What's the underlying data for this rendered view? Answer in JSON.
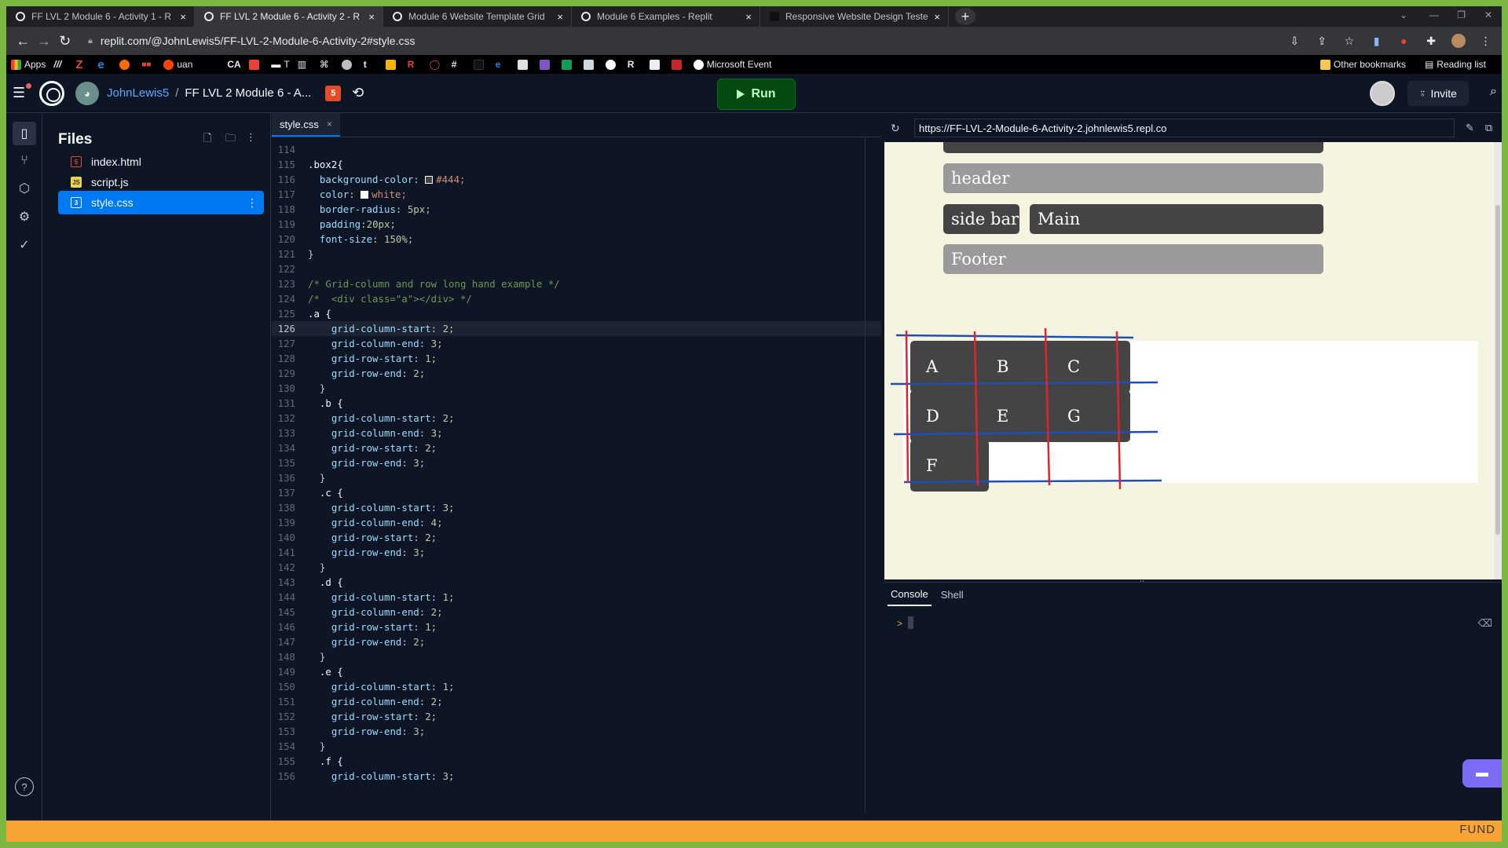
{
  "browser": {
    "tabs": [
      {
        "title": "FF LVL 2 Module 6 - Activity 1 - R",
        "active": false
      },
      {
        "title": "FF LVL 2 Module 6 - Activity 2 - R",
        "active": true
      },
      {
        "title": "Module 6 Website Template Grid",
        "active": false
      },
      {
        "title": "Module 6 Examples - Replit",
        "active": false
      },
      {
        "title": "Responsive Website Design Teste",
        "active": false
      }
    ],
    "url": "replit.com/@JohnLewis5/FF-LVL-2-Module-6-Activity-2#style.css",
    "bookmarks": {
      "apps": "Apps",
      "uan": "uan",
      "ca": "CA",
      "t": "T",
      "microsoft_event": "Microsoft Event",
      "other": "Other bookmarks",
      "reading_list": "Reading list"
    }
  },
  "replit": {
    "owner": "JohnLewis5",
    "separator": "/",
    "repl_name": "FF LVL 2 Module 6 - A...",
    "run_label": "Run",
    "invite_label": "Invite",
    "files_title": "Files",
    "files": [
      {
        "name": "index.html",
        "type": "html"
      },
      {
        "name": "script.js",
        "type": "js"
      },
      {
        "name": "style.css",
        "type": "css",
        "active": true
      }
    ],
    "editor_tab": "style.css",
    "help": "?"
  },
  "code_lines": [
    {
      "n": "114",
      "t": ""
    },
    {
      "n": "115",
      "t": ".box2{"
    },
    {
      "n": "116",
      "t": "  background-color: ",
      "sw": "#444",
      "v": "#444;"
    },
    {
      "n": "117",
      "t": "  color: ",
      "sw": "#ffffff",
      "v": "white;"
    },
    {
      "n": "118",
      "t": "  border-radius: 5px;"
    },
    {
      "n": "119",
      "t": "  padding:20px;"
    },
    {
      "n": "120",
      "t": "  font-size: 150%;"
    },
    {
      "n": "121",
      "t": "}"
    },
    {
      "n": "122",
      "t": ""
    },
    {
      "n": "123",
      "t": "/* Grid-column and row long hand example */",
      "c": true
    },
    {
      "n": "124",
      "t": "/*  <div class=\"a\"></div> */",
      "c": true
    },
    {
      "n": "125",
      "t": ".a {"
    },
    {
      "n": "126",
      "t": "    grid-column-start: 2;",
      "cur": true
    },
    {
      "n": "127",
      "t": "    grid-column-end: 3;"
    },
    {
      "n": "128",
      "t": "    grid-row-start: 1;"
    },
    {
      "n": "129",
      "t": "    grid-row-end: 2;"
    },
    {
      "n": "130",
      "t": "  }"
    },
    {
      "n": "131",
      "t": "  .b {"
    },
    {
      "n": "132",
      "t": "    grid-column-start: 2;"
    },
    {
      "n": "133",
      "t": "    grid-column-end: 3;"
    },
    {
      "n": "134",
      "t": "    grid-row-start: 2;"
    },
    {
      "n": "135",
      "t": "    grid-row-end: 3;"
    },
    {
      "n": "136",
      "t": "  }"
    },
    {
      "n": "137",
      "t": "  .c {"
    },
    {
      "n": "138",
      "t": "    grid-column-start: 3;"
    },
    {
      "n": "139",
      "t": "    grid-column-end: 4;"
    },
    {
      "n": "140",
      "t": "    grid-row-start: 2;"
    },
    {
      "n": "141",
      "t": "    grid-row-end: 3;"
    },
    {
      "n": "142",
      "t": "  }"
    },
    {
      "n": "143",
      "t": "  .d {"
    },
    {
      "n": "144",
      "t": "    grid-column-start: 1;"
    },
    {
      "n": "145",
      "t": "    grid-column-end: 2;"
    },
    {
      "n": "146",
      "t": "    grid-row-start: 1;"
    },
    {
      "n": "147",
      "t": "    grid-row-end: 2;"
    },
    {
      "n": "148",
      "t": "  }"
    },
    {
      "n": "149",
      "t": "  .e {"
    },
    {
      "n": "150",
      "t": "    grid-column-start: 1;"
    },
    {
      "n": "151",
      "t": "    grid-column-end: 2;"
    },
    {
      "n": "152",
      "t": "    grid-row-start: 2;"
    },
    {
      "n": "153",
      "t": "    grid-row-end: 3;"
    },
    {
      "n": "154",
      "t": "  }"
    },
    {
      "n": "155",
      "t": "  .f {"
    },
    {
      "n": "156",
      "t": "    grid-column-start: 3;"
    }
  ],
  "webview": {
    "url": "https://FF-LVL-2-Module-6-Activity-2.johnlewis5.repl.co",
    "header": "header",
    "sidebar": "side bar",
    "main": "Main",
    "footer": "Footer",
    "cells": [
      "A",
      "B",
      "C",
      "D",
      "E",
      "G",
      "F"
    ]
  },
  "console": {
    "tabs": [
      "Console",
      "Shell"
    ],
    "prompt": ">"
  },
  "banner": {
    "text": "FUND"
  }
}
